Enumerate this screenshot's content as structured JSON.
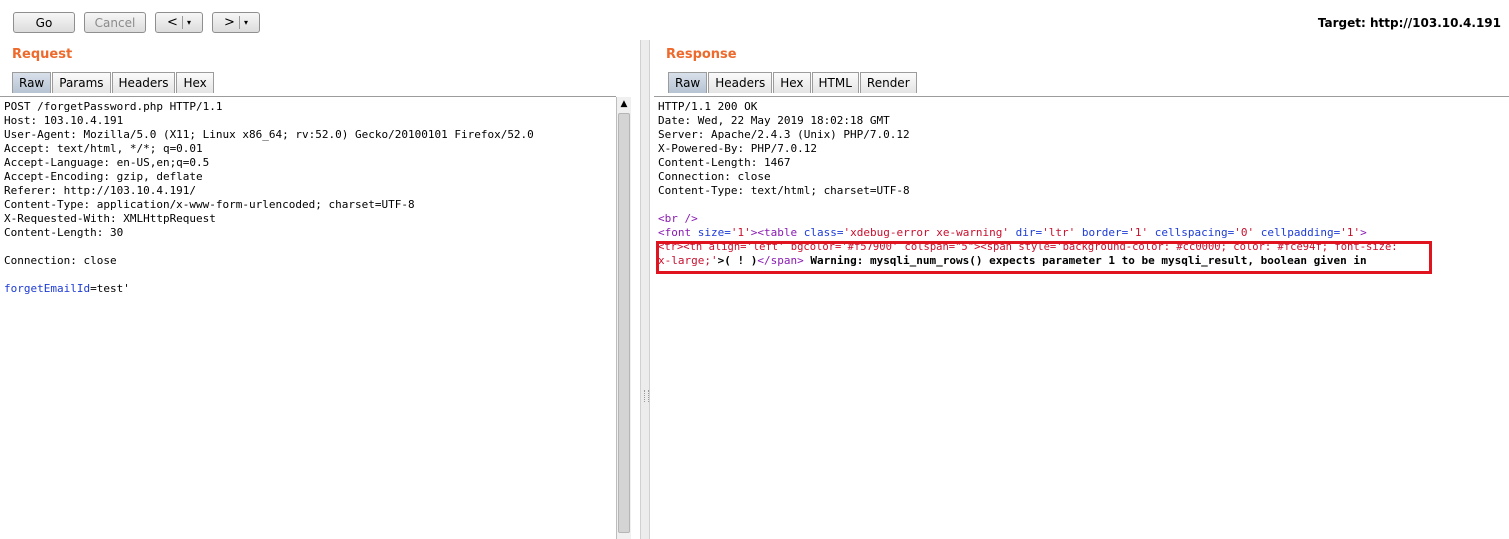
{
  "toolbar": {
    "go_label": "Go",
    "cancel_label": "Cancel",
    "back_arrow": "<",
    "forward_arrow": ">",
    "dropdown_glyph": "▾",
    "target_text": "Target: http://103.10.4.191"
  },
  "request": {
    "title": "Request",
    "tabs": [
      "Raw",
      "Params",
      "Headers",
      "Hex"
    ],
    "active_tab": "Raw",
    "lines": [
      "POST /forgetPassword.php HTTP/1.1",
      "Host: 103.10.4.191",
      "User-Agent: Mozilla/5.0 (X11; Linux x86_64; rv:52.0) Gecko/20100101 Firefox/52.0",
      "Accept: text/html, */*; q=0.01",
      "Accept-Language: en-US,en;q=0.5",
      "Accept-Encoding: gzip, deflate",
      "Referer: http://103.10.4.191/",
      "Content-Type: application/x-www-form-urlencoded; charset=UTF-8",
      "X-Requested-With: XMLHttpRequest",
      "Content-Length: 30",
      "",
      "Connection: close",
      ""
    ],
    "body_param_name": "forgetEmailId",
    "body_param_value": "=test'"
  },
  "response": {
    "title": "Response",
    "tabs": [
      "Raw",
      "Headers",
      "Hex",
      "HTML",
      "Render"
    ],
    "active_tab": "Raw",
    "header_lines": [
      "HTTP/1.1 200 OK",
      "Date: Wed, 22 May 2019 18:02:18 GMT",
      "Server: Apache/2.4.3 (Unix) PHP/7.0.12",
      "X-Powered-By: PHP/7.0.12",
      "Content-Length: 1467",
      "Connection: close",
      "Content-Type: text/html; charset=UTF-8"
    ],
    "br_tag": "<br />",
    "font_tag_open": "<font ",
    "attr_size": "size=",
    "val_size": "'1'",
    "table_open": "><table ",
    "attr_class": "class=",
    "val_class": "'xdebug-error xe-warning'",
    "attr_dir": " dir=",
    "val_dir": "'ltr'",
    "attr_border": " border=",
    "val_border": "'1'",
    "attr_cellspacing": " cellspacing=",
    "val_cellspacing": "'0'",
    "attr_cellpadding": " cellpadding=",
    "val_cellpadding": "'1'",
    "table_close": ">",
    "line3_text": "<tr><th align='left' bgcolor='#f57900' colspan=\"5\"><span style='background-color: #cc0000; color: #fce94f; font-size:",
    "line4_style_end": "x-large;'",
    "line4_mark": ">( ! )",
    "line4_span_close": "</span>",
    "line4_warning": " Warning: mysqli_num_rows() expects parameter 1 to be mysqli_result, boolean given in"
  },
  "colors": {
    "accent_title": "#ee6a2c",
    "highlight_box": "#e0141e",
    "attr_name": "#1d3bd6",
    "attr_value": "#c8102e",
    "tag": "#8a1bb3"
  }
}
